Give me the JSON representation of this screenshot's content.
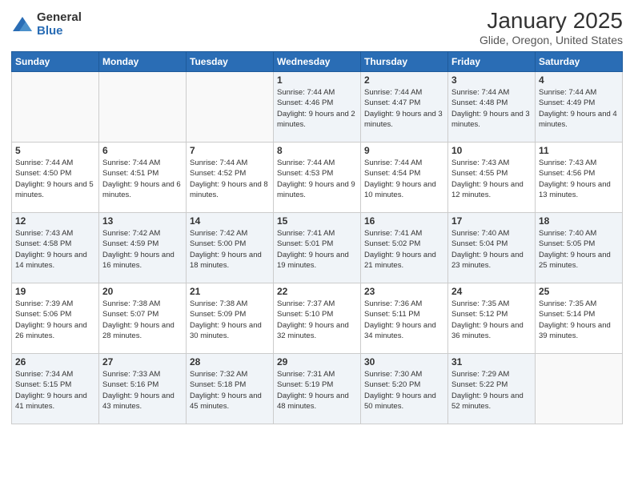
{
  "logo": {
    "general": "General",
    "blue": "Blue"
  },
  "title": "January 2025",
  "subtitle": "Glide, Oregon, United States",
  "weekdays": [
    "Sunday",
    "Monday",
    "Tuesday",
    "Wednesday",
    "Thursday",
    "Friday",
    "Saturday"
  ],
  "weeks": [
    [
      {
        "day": "",
        "sunrise": "",
        "sunset": "",
        "daylight": ""
      },
      {
        "day": "",
        "sunrise": "",
        "sunset": "",
        "daylight": ""
      },
      {
        "day": "",
        "sunrise": "",
        "sunset": "",
        "daylight": ""
      },
      {
        "day": "1",
        "sunrise": "Sunrise: 7:44 AM",
        "sunset": "Sunset: 4:46 PM",
        "daylight": "Daylight: 9 hours and 2 minutes."
      },
      {
        "day": "2",
        "sunrise": "Sunrise: 7:44 AM",
        "sunset": "Sunset: 4:47 PM",
        "daylight": "Daylight: 9 hours and 3 minutes."
      },
      {
        "day": "3",
        "sunrise": "Sunrise: 7:44 AM",
        "sunset": "Sunset: 4:48 PM",
        "daylight": "Daylight: 9 hours and 3 minutes."
      },
      {
        "day": "4",
        "sunrise": "Sunrise: 7:44 AM",
        "sunset": "Sunset: 4:49 PM",
        "daylight": "Daylight: 9 hours and 4 minutes."
      }
    ],
    [
      {
        "day": "5",
        "sunrise": "Sunrise: 7:44 AM",
        "sunset": "Sunset: 4:50 PM",
        "daylight": "Daylight: 9 hours and 5 minutes."
      },
      {
        "day": "6",
        "sunrise": "Sunrise: 7:44 AM",
        "sunset": "Sunset: 4:51 PM",
        "daylight": "Daylight: 9 hours and 6 minutes."
      },
      {
        "day": "7",
        "sunrise": "Sunrise: 7:44 AM",
        "sunset": "Sunset: 4:52 PM",
        "daylight": "Daylight: 9 hours and 8 minutes."
      },
      {
        "day": "8",
        "sunrise": "Sunrise: 7:44 AM",
        "sunset": "Sunset: 4:53 PM",
        "daylight": "Daylight: 9 hours and 9 minutes."
      },
      {
        "day": "9",
        "sunrise": "Sunrise: 7:44 AM",
        "sunset": "Sunset: 4:54 PM",
        "daylight": "Daylight: 9 hours and 10 minutes."
      },
      {
        "day": "10",
        "sunrise": "Sunrise: 7:43 AM",
        "sunset": "Sunset: 4:55 PM",
        "daylight": "Daylight: 9 hours and 12 minutes."
      },
      {
        "day": "11",
        "sunrise": "Sunrise: 7:43 AM",
        "sunset": "Sunset: 4:56 PM",
        "daylight": "Daylight: 9 hours and 13 minutes."
      }
    ],
    [
      {
        "day": "12",
        "sunrise": "Sunrise: 7:43 AM",
        "sunset": "Sunset: 4:58 PM",
        "daylight": "Daylight: 9 hours and 14 minutes."
      },
      {
        "day": "13",
        "sunrise": "Sunrise: 7:42 AM",
        "sunset": "Sunset: 4:59 PM",
        "daylight": "Daylight: 9 hours and 16 minutes."
      },
      {
        "day": "14",
        "sunrise": "Sunrise: 7:42 AM",
        "sunset": "Sunset: 5:00 PM",
        "daylight": "Daylight: 9 hours and 18 minutes."
      },
      {
        "day": "15",
        "sunrise": "Sunrise: 7:41 AM",
        "sunset": "Sunset: 5:01 PM",
        "daylight": "Daylight: 9 hours and 19 minutes."
      },
      {
        "day": "16",
        "sunrise": "Sunrise: 7:41 AM",
        "sunset": "Sunset: 5:02 PM",
        "daylight": "Daylight: 9 hours and 21 minutes."
      },
      {
        "day": "17",
        "sunrise": "Sunrise: 7:40 AM",
        "sunset": "Sunset: 5:04 PM",
        "daylight": "Daylight: 9 hours and 23 minutes."
      },
      {
        "day": "18",
        "sunrise": "Sunrise: 7:40 AM",
        "sunset": "Sunset: 5:05 PM",
        "daylight": "Daylight: 9 hours and 25 minutes."
      }
    ],
    [
      {
        "day": "19",
        "sunrise": "Sunrise: 7:39 AM",
        "sunset": "Sunset: 5:06 PM",
        "daylight": "Daylight: 9 hours and 26 minutes."
      },
      {
        "day": "20",
        "sunrise": "Sunrise: 7:38 AM",
        "sunset": "Sunset: 5:07 PM",
        "daylight": "Daylight: 9 hours and 28 minutes."
      },
      {
        "day": "21",
        "sunrise": "Sunrise: 7:38 AM",
        "sunset": "Sunset: 5:09 PM",
        "daylight": "Daylight: 9 hours and 30 minutes."
      },
      {
        "day": "22",
        "sunrise": "Sunrise: 7:37 AM",
        "sunset": "Sunset: 5:10 PM",
        "daylight": "Daylight: 9 hours and 32 minutes."
      },
      {
        "day": "23",
        "sunrise": "Sunrise: 7:36 AM",
        "sunset": "Sunset: 5:11 PM",
        "daylight": "Daylight: 9 hours and 34 minutes."
      },
      {
        "day": "24",
        "sunrise": "Sunrise: 7:35 AM",
        "sunset": "Sunset: 5:12 PM",
        "daylight": "Daylight: 9 hours and 36 minutes."
      },
      {
        "day": "25",
        "sunrise": "Sunrise: 7:35 AM",
        "sunset": "Sunset: 5:14 PM",
        "daylight": "Daylight: 9 hours and 39 minutes."
      }
    ],
    [
      {
        "day": "26",
        "sunrise": "Sunrise: 7:34 AM",
        "sunset": "Sunset: 5:15 PM",
        "daylight": "Daylight: 9 hours and 41 minutes."
      },
      {
        "day": "27",
        "sunrise": "Sunrise: 7:33 AM",
        "sunset": "Sunset: 5:16 PM",
        "daylight": "Daylight: 9 hours and 43 minutes."
      },
      {
        "day": "28",
        "sunrise": "Sunrise: 7:32 AM",
        "sunset": "Sunset: 5:18 PM",
        "daylight": "Daylight: 9 hours and 45 minutes."
      },
      {
        "day": "29",
        "sunrise": "Sunrise: 7:31 AM",
        "sunset": "Sunset: 5:19 PM",
        "daylight": "Daylight: 9 hours and 48 minutes."
      },
      {
        "day": "30",
        "sunrise": "Sunrise: 7:30 AM",
        "sunset": "Sunset: 5:20 PM",
        "daylight": "Daylight: 9 hours and 50 minutes."
      },
      {
        "day": "31",
        "sunrise": "Sunrise: 7:29 AM",
        "sunset": "Sunset: 5:22 PM",
        "daylight": "Daylight: 9 hours and 52 minutes."
      },
      {
        "day": "",
        "sunrise": "",
        "sunset": "",
        "daylight": ""
      }
    ]
  ]
}
